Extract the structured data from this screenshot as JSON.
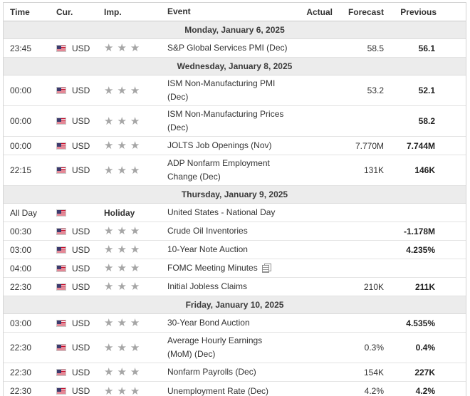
{
  "columns": {
    "time": "Time",
    "currency": "Cur.",
    "importance": "Imp.",
    "event": "Event",
    "actual": "Actual",
    "forecast": "Forecast",
    "previous": "Previous"
  },
  "colors": {
    "star": "#a6a6a6",
    "day_header_bg": "#ececec"
  },
  "days": [
    {
      "label": "Monday, January 6, 2025",
      "rows": [
        {
          "time": "23:45",
          "cur": "USD",
          "stars": 3,
          "event": "S&P Global Services PMI (Dec)",
          "actual": "",
          "forecast": "58.5",
          "previous": "56.1",
          "tall": false
        }
      ]
    },
    {
      "label": "Wednesday, January 8, 2025",
      "rows": [
        {
          "time": "00:00",
          "cur": "USD",
          "stars": 3,
          "event": "ISM Non-Manufacturing PMI (Dec)",
          "actual": "",
          "forecast": "53.2",
          "previous": "52.1",
          "tall": true
        },
        {
          "time": "00:00",
          "cur": "USD",
          "stars": 3,
          "event": "ISM Non-Manufacturing Prices (Dec)",
          "actual": "",
          "forecast": "",
          "previous": "58.2",
          "tall": true
        },
        {
          "time": "00:00",
          "cur": "USD",
          "stars": 3,
          "event": "JOLTS Job Openings (Nov)",
          "actual": "",
          "forecast": "7.770M",
          "previous": "7.744M",
          "tall": false
        },
        {
          "time": "22:15",
          "cur": "USD",
          "stars": 3,
          "event": "ADP Nonfarm Employment Change (Dec)",
          "actual": "",
          "forecast": "131K",
          "previous": "146K",
          "tall": true
        }
      ]
    },
    {
      "label": "Thursday, January 9, 2025",
      "rows": [
        {
          "time": "All Day",
          "cur": "",
          "stars": 0,
          "holiday": "Holiday",
          "event": "United States - National Day",
          "actual": "",
          "forecast": "",
          "previous": "",
          "tall": false
        },
        {
          "time": "00:30",
          "cur": "USD",
          "stars": 3,
          "event": "Crude Oil Inventories",
          "actual": "",
          "forecast": "",
          "previous": "-1.178M",
          "tall": false
        },
        {
          "time": "03:00",
          "cur": "USD",
          "stars": 3,
          "event": "10-Year Note Auction",
          "actual": "",
          "forecast": "",
          "previous": "4.235%",
          "tall": false
        },
        {
          "time": "04:00",
          "cur": "USD",
          "stars": 3,
          "event": "FOMC Meeting Minutes",
          "actual": "",
          "forecast": "",
          "previous": "",
          "tall": false,
          "doc_icon": "document-icon"
        },
        {
          "time": "22:30",
          "cur": "USD",
          "stars": 3,
          "event": "Initial Jobless Claims",
          "actual": "",
          "forecast": "210K",
          "previous": "211K",
          "tall": false
        }
      ]
    },
    {
      "label": "Friday, January 10, 2025",
      "rows": [
        {
          "time": "03:00",
          "cur": "USD",
          "stars": 3,
          "event": "30-Year Bond Auction",
          "actual": "",
          "forecast": "",
          "previous": "4.535%",
          "tall": false
        },
        {
          "time": "22:30",
          "cur": "USD",
          "stars": 3,
          "event": "Average Hourly Earnings (MoM) (Dec)",
          "actual": "",
          "forecast": "0.3%",
          "previous": "0.4%",
          "tall": true
        },
        {
          "time": "22:30",
          "cur": "USD",
          "stars": 3,
          "event": "Nonfarm Payrolls (Dec)",
          "actual": "",
          "forecast": "154K",
          "previous": "227K",
          "tall": false
        },
        {
          "time": "22:30",
          "cur": "USD",
          "stars": 3,
          "event": "Unemployment Rate (Dec)",
          "actual": "",
          "forecast": "4.2%",
          "previous": "4.2%",
          "tall": false
        }
      ]
    }
  ]
}
